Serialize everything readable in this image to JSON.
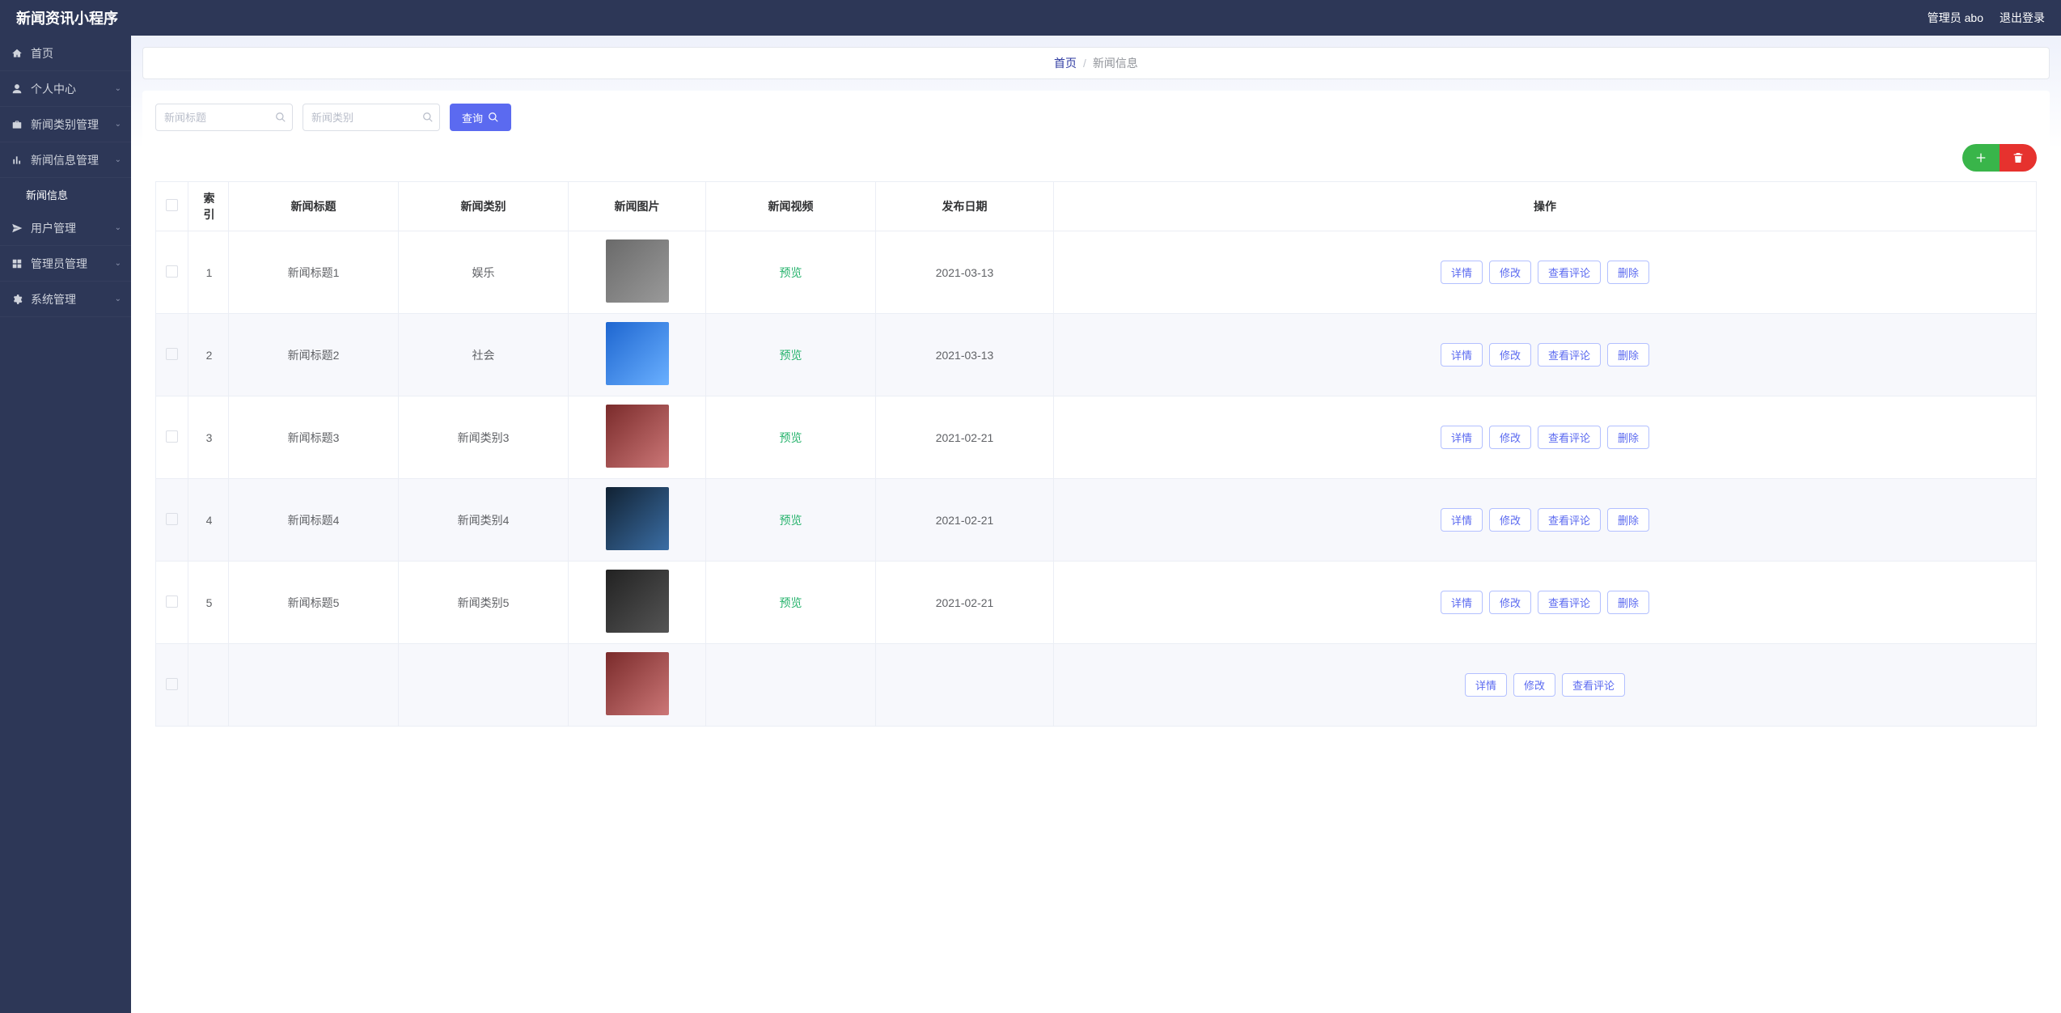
{
  "topbar": {
    "brand": "新闻资讯小程序",
    "user_label": "管理员 abo",
    "logout_label": "退出登录"
  },
  "sidebar": {
    "items": [
      {
        "icon": "home",
        "label": "首页",
        "expandable": false
      },
      {
        "icon": "user",
        "label": "个人中心",
        "expandable": true
      },
      {
        "icon": "briefcase",
        "label": "新闻类别管理",
        "expandable": true
      },
      {
        "icon": "bars",
        "label": "新闻信息管理",
        "expandable": true,
        "expanded": true,
        "children": [
          "新闻信息"
        ]
      },
      {
        "icon": "send",
        "label": "用户管理",
        "expandable": true
      },
      {
        "icon": "grid",
        "label": "管理员管理",
        "expandable": true
      },
      {
        "icon": "gear",
        "label": "系统管理",
        "expandable": true
      }
    ]
  },
  "breadcrumb": {
    "home": "首页",
    "current": "新闻信息"
  },
  "filters": {
    "title_placeholder": "新闻标题",
    "category_placeholder": "新闻类别",
    "search_label": "查询"
  },
  "table": {
    "headers": {
      "index": "索引",
      "title": "新闻标题",
      "category": "新闻类别",
      "image": "新闻图片",
      "video": "新闻视频",
      "date": "发布日期",
      "ops": "操作"
    },
    "video_link_label": "预览",
    "op_labels": {
      "detail": "详情",
      "edit": "修改",
      "comments": "查看评论",
      "delete": "删除"
    },
    "rows": [
      {
        "idx": "1",
        "title": "新闻标题1",
        "category": "娱乐",
        "date": "2021-03-13"
      },
      {
        "idx": "2",
        "title": "新闻标题2",
        "category": "社会",
        "date": "2021-03-13"
      },
      {
        "idx": "3",
        "title": "新闻标题3",
        "category": "新闻类别3",
        "date": "2021-02-21"
      },
      {
        "idx": "4",
        "title": "新闻标题4",
        "category": "新闻类别4",
        "date": "2021-02-21"
      },
      {
        "idx": "5",
        "title": "新闻标题5",
        "category": "新闻类别5",
        "date": "2021-02-21"
      }
    ]
  },
  "colors": {
    "nav_bg": "#2d3757",
    "primary": "#5b6af0",
    "success": "#39b54a",
    "danger": "#e6322e",
    "link_green": "#27b36d"
  }
}
